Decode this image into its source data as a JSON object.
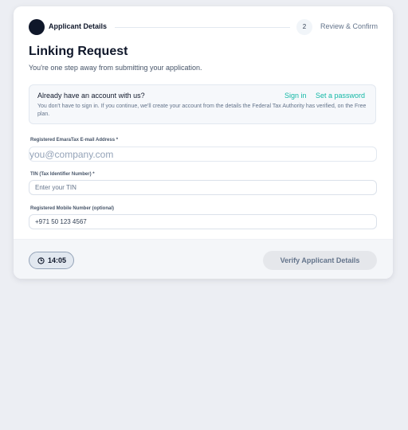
{
  "stepper": {
    "step1_label": "Applicant Details",
    "step2_number": "2",
    "step2_label": "Review & Confirm"
  },
  "header": {
    "title": "Linking Request",
    "subtitle": "You're one step away from submitting your application."
  },
  "info": {
    "title": "Already have an account with us?",
    "sign_in": "Sign in",
    "set_password": "Set a password",
    "body": "You don't have to sign in. If you continue, we'll create your account from the details the Federal Tax Authority has verified, on the Free plan."
  },
  "fields": {
    "email": {
      "label": "Registered EmaraTax E-mail Address *",
      "placeholder": "you@company.com",
      "value": ""
    },
    "tin": {
      "label": "TIN (Tax Identifier Number) *",
      "placeholder": "Enter your TIN",
      "value": ""
    },
    "mobile": {
      "label": "Registered Mobile Number (optional)",
      "placeholder": "",
      "value": "+971 50 123 4567"
    }
  },
  "footer": {
    "timer": "14:05",
    "verify_label": "Verify Applicant Details"
  },
  "icons": {
    "timer": "clock-icon"
  },
  "colors": {
    "accent": "#14b8a6",
    "primary": "#0f172a",
    "background": "#eceef3"
  }
}
